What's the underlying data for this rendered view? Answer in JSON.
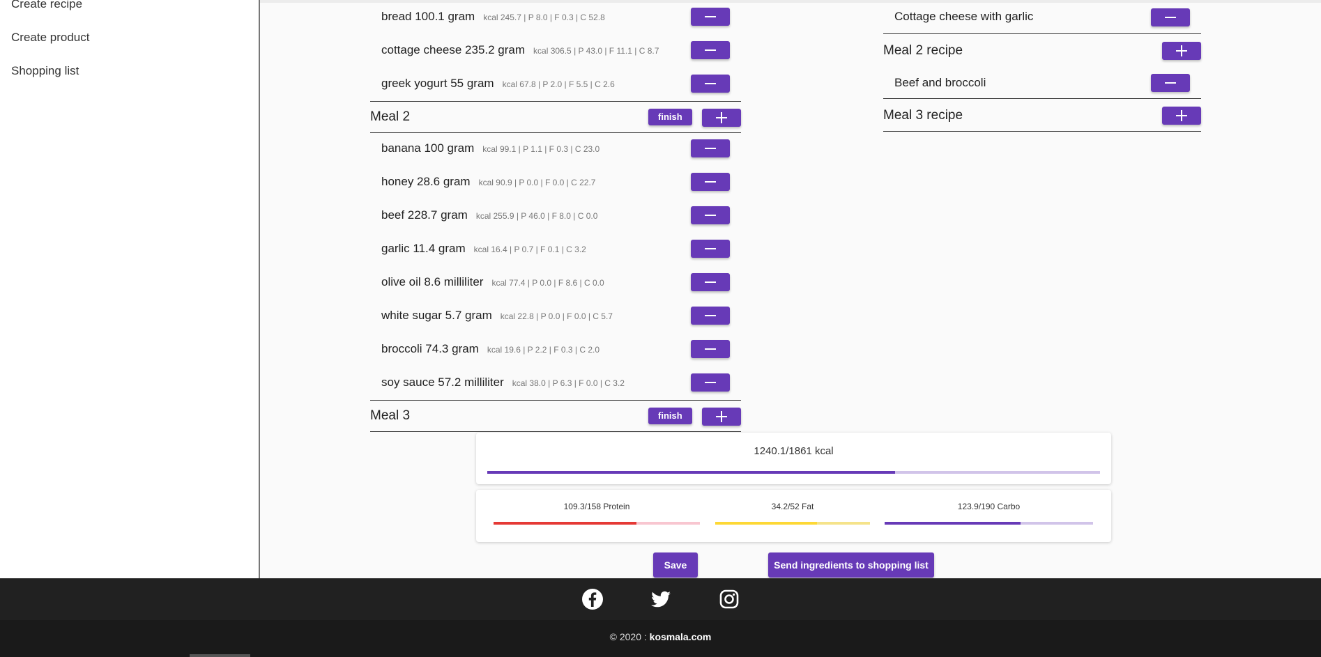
{
  "sidebar": {
    "items": [
      {
        "label": "Create recipe"
      },
      {
        "label": "Create product"
      },
      {
        "label": "Shopping list"
      }
    ]
  },
  "meal1": {
    "ingredients": [
      {
        "name": "bread 100.1 gram",
        "macros": "kcal 245.7 | P 8.0 | F 0.3 | C 52.8"
      },
      {
        "name": "cottage cheese 235.2 gram",
        "macros": "kcal 306.5 | P 43.0 | F 11.1 | C 8.7"
      },
      {
        "name": "greek yogurt 55 gram",
        "macros": "kcal 67.8 | P 2.0 | F 5.5 | C 2.6"
      }
    ]
  },
  "meal2": {
    "title": "Meal 2",
    "finish_label": "finish",
    "ingredients": [
      {
        "name": "banana 100 gram",
        "macros": "kcal 99.1 | P 1.1 | F 0.3 | C 23.0"
      },
      {
        "name": "honey 28.6 gram",
        "macros": "kcal 90.9 | P 0.0 | F 0.0 | C 22.7"
      },
      {
        "name": "beef 228.7 gram",
        "macros": "kcal 255.9 | P 46.0 | F 8.0 | C 0.0"
      },
      {
        "name": "garlic 11.4 gram",
        "macros": "kcal 16.4 | P 0.7 | F 0.1 | C 3.2"
      },
      {
        "name": "olive oil 8.6 milliliter",
        "macros": "kcal 77.4 | P 0.0 | F 8.6 | C 0.0"
      },
      {
        "name": "white sugar 5.7 gram",
        "macros": "kcal 22.8 | P 0.0 | F 0.0 | C 5.7"
      },
      {
        "name": "broccoli 74.3 gram",
        "macros": "kcal 19.6 | P 2.2 | F 0.3 | C 2.0"
      },
      {
        "name": "soy sauce 57.2 milliliter",
        "macros": "kcal 38.0 | P 6.3 | F 0.0 | C 3.2"
      }
    ]
  },
  "meal3": {
    "title": "Meal 3",
    "finish_label": "finish"
  },
  "recipes": {
    "meal1_recipe": "Cottage cheese with garlic",
    "meal2_title": "Meal 2 recipe",
    "meal2_recipe": "Beef and broccoli",
    "meal3_title": "Meal 3 recipe"
  },
  "summary": {
    "kcal_text": "1240.1/1861 kcal",
    "kcal_progress": 0.666,
    "protein_text": "109.3/158 Protein",
    "protein_progress": 0.692,
    "fat_text": "34.2/52 Fat",
    "fat_progress": 0.658,
    "carbo_text": "123.9/190 Carbo",
    "carbo_progress": 0.652
  },
  "actions": {
    "save_label": "Save",
    "send_label": "Send ingredients to shopping list"
  },
  "footer": {
    "copyright_prefix": "© 2020 :",
    "site": "kosmala.com",
    "social": [
      "facebook-icon",
      "twitter-icon",
      "instagram-icon"
    ]
  },
  "colors": {
    "accent": "#673ab7",
    "protein": "#e53935",
    "fat": "#fdd835",
    "carbo": "#673ab7"
  }
}
